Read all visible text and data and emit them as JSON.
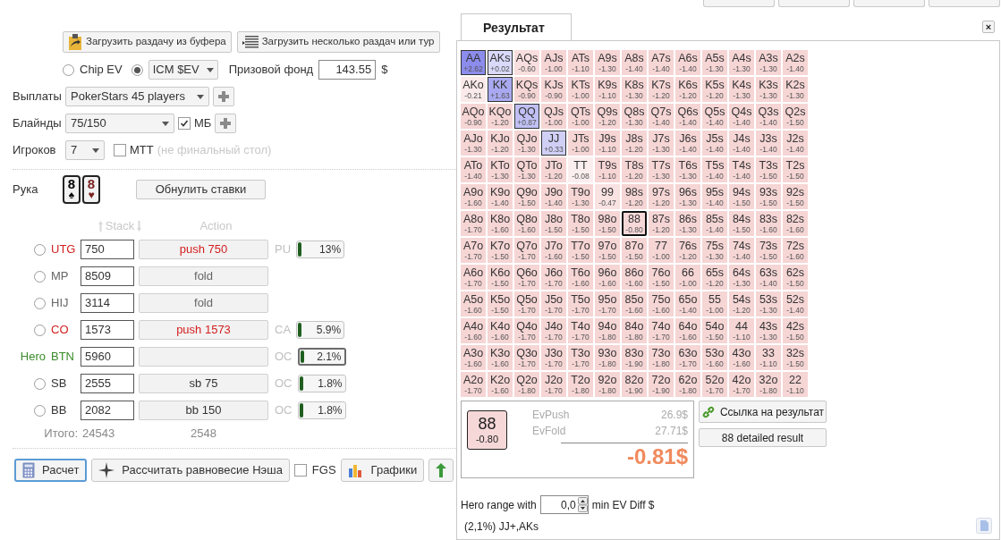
{
  "load_buttons": [
    {
      "kind": "clipboard",
      "label": "Загрузить раздачу из буфера"
    },
    {
      "kind": "list",
      "label": "Загрузить несколько раздач или тур"
    }
  ],
  "ev_options": [
    {
      "kind": "radio",
      "label": "Chip EV",
      "selected": false
    },
    {
      "kind": "dropdown",
      "label": "ICM $EV",
      "selected": true
    }
  ],
  "prize_pool": {
    "label": "Призовой фонд",
    "value": "143.55",
    "unit": "$"
  },
  "payouts": {
    "label": "Выплаты",
    "value": "PokerStars 45 players"
  },
  "blinds": {
    "label": "Блайнды",
    "value": "75/150",
    "ante_label": "МБ",
    "ante_checked": true
  },
  "players_count": {
    "label": "Игроков",
    "value": "7",
    "mtt_label": "МТТ",
    "mtt_checked": false,
    "mtt_note": "(не финальный стол)"
  },
  "hand": {
    "label": "Рука",
    "reset_button": "Обнулить ставки",
    "cards": [
      {
        "rank": "8",
        "suit": "♠",
        "color": "#000000"
      },
      {
        "rank": "8",
        "suit": "♥",
        "color": "#7a1f1f"
      }
    ]
  },
  "columns": {
    "stack": "Stack",
    "action": "Action"
  },
  "players": [
    {
      "position": "UTG",
      "hero": false,
      "selected": false,
      "stack": "750",
      "kind": "push",
      "action": "push 750",
      "stat": {
        "label": "PU",
        "level": 0.13,
        "value": "13%"
      }
    },
    {
      "position": "MP",
      "hero": false,
      "selected": false,
      "stack": "8509",
      "kind": "fold",
      "action": "fold"
    },
    {
      "position": "HIJ",
      "hero": false,
      "selected": false,
      "stack": "3114",
      "kind": "fold",
      "action": "fold"
    },
    {
      "position": "CO",
      "hero": false,
      "selected": false,
      "stack": "1573",
      "kind": "push",
      "action": "push 1573",
      "stat": {
        "label": "CA",
        "level": 0.059,
        "value": "5.9%"
      }
    },
    {
      "position": "BTN",
      "hero": true,
      "tag": "Hero",
      "stack": "5960",
      "kind": "none",
      "stat": {
        "label": "OC",
        "level": 0.021,
        "value": "2.1%"
      }
    },
    {
      "position": "SB",
      "hero": false,
      "selected": false,
      "stack": "2555",
      "kind": "post",
      "action": "sb 75",
      "stat": {
        "label": "OC",
        "level": 0.018,
        "value": "1.8%"
      }
    },
    {
      "position": "BB",
      "hero": false,
      "selected": false,
      "stack": "2082",
      "kind": "post",
      "action": "bb 150",
      "stat": {
        "label": "OC",
        "level": 0.018,
        "value": "1.8%"
      }
    }
  ],
  "totals": {
    "label": "Итого:",
    "stack": "24543",
    "action": "2548"
  },
  "actions": [
    {
      "kind": "calculate",
      "label": "Расчет",
      "selected": true
    },
    {
      "kind": "nash",
      "label": "Рассчитать равновесие Нэша",
      "selected": false
    },
    {
      "kind": "checkbox",
      "label": "FGS",
      "checked": false
    },
    {
      "kind": "charts",
      "label": "Графики",
      "selected": false
    },
    {
      "kind": "export",
      "selected": false
    }
  ],
  "result": {
    "tab": "Результат",
    "close": "×",
    "grid": [
      [
        {
          "hand": "AA",
          "ev": "+2.62",
          "in_range": true,
          "current": false
        },
        {
          "hand": "AKs",
          "ev": "+0.02",
          "in_range": true,
          "current": false
        },
        {
          "hand": "AQs",
          "ev": "-0.60",
          "in_range": false,
          "current": false
        },
        {
          "hand": "AJs",
          "ev": "-1.00",
          "in_range": false,
          "current": false
        },
        {
          "hand": "ATs",
          "ev": "-1.10",
          "in_range": false,
          "current": false
        },
        {
          "hand": "A9s",
          "ev": "-1.30",
          "in_range": false,
          "current": false
        },
        {
          "hand": "A8s",
          "ev": "-1.40",
          "in_range": false,
          "current": false
        },
        {
          "hand": "A7s",
          "ev": "-1.40",
          "in_range": false,
          "current": false
        },
        {
          "hand": "A6s",
          "ev": "-1.40",
          "in_range": false,
          "current": false
        },
        {
          "hand": "A5s",
          "ev": "-1.30",
          "in_range": false,
          "current": false
        },
        {
          "hand": "A4s",
          "ev": "-1.30",
          "in_range": false,
          "current": false
        },
        {
          "hand": "A3s",
          "ev": "-1.30",
          "in_range": false,
          "current": false
        },
        {
          "hand": "A2s",
          "ev": "-1.40",
          "in_range": false,
          "current": false
        }
      ],
      [
        {
          "hand": "AKo",
          "ev": "-0.21",
          "in_range": false,
          "current": false
        },
        {
          "hand": "KK",
          "ev": "+1.63",
          "in_range": true,
          "current": false
        },
        {
          "hand": "KQs",
          "ev": "-0.90",
          "in_range": false,
          "current": false
        },
        {
          "hand": "KJs",
          "ev": "-0.90",
          "in_range": false,
          "current": false
        },
        {
          "hand": "KTs",
          "ev": "-1.00",
          "in_range": false,
          "current": false
        },
        {
          "hand": "K9s",
          "ev": "-1.10",
          "in_range": false,
          "current": false
        },
        {
          "hand": "K8s",
          "ev": "-1.30",
          "in_range": false,
          "current": false
        },
        {
          "hand": "K7s",
          "ev": "-1.20",
          "in_range": false,
          "current": false
        },
        {
          "hand": "K6s",
          "ev": "-1.20",
          "in_range": false,
          "current": false
        },
        {
          "hand": "K5s",
          "ev": "-1.20",
          "in_range": false,
          "current": false
        },
        {
          "hand": "K4s",
          "ev": "-1.30",
          "in_range": false,
          "current": false
        },
        {
          "hand": "K3s",
          "ev": "-1.30",
          "in_range": false,
          "current": false
        },
        {
          "hand": "K2s",
          "ev": "-1.30",
          "in_range": false,
          "current": false
        }
      ],
      [
        {
          "hand": "AQo",
          "ev": "-0.90",
          "in_range": false,
          "current": false
        },
        {
          "hand": "KQo",
          "ev": "-1.20",
          "in_range": false,
          "current": false
        },
        {
          "hand": "QQ",
          "ev": "+0.87",
          "in_range": true,
          "current": false
        },
        {
          "hand": "QJs",
          "ev": "-1.00",
          "in_range": false,
          "current": false
        },
        {
          "hand": "QTs",
          "ev": "-1.00",
          "in_range": false,
          "current": false
        },
        {
          "hand": "Q9s",
          "ev": "-1.20",
          "in_range": false,
          "current": false
        },
        {
          "hand": "Q8s",
          "ev": "-1.30",
          "in_range": false,
          "current": false
        },
        {
          "hand": "Q7s",
          "ev": "-1.40",
          "in_range": false,
          "current": false
        },
        {
          "hand": "Q6s",
          "ev": "-1.40",
          "in_range": false,
          "current": false
        },
        {
          "hand": "Q5s",
          "ev": "-1.40",
          "in_range": false,
          "current": false
        },
        {
          "hand": "Q4s",
          "ev": "-1.40",
          "in_range": false,
          "current": false
        },
        {
          "hand": "Q3s",
          "ev": "-1.40",
          "in_range": false,
          "current": false
        },
        {
          "hand": "Q2s",
          "ev": "-1.50",
          "in_range": false,
          "current": false
        }
      ],
      [
        {
          "hand": "AJo",
          "ev": "-1.30",
          "in_range": false,
          "current": false
        },
        {
          "hand": "KJo",
          "ev": "-1.20",
          "in_range": false,
          "current": false
        },
        {
          "hand": "QJo",
          "ev": "-1.30",
          "in_range": false,
          "current": false
        },
        {
          "hand": "JJ",
          "ev": "+0.33",
          "in_range": true,
          "current": false
        },
        {
          "hand": "JTs",
          "ev": "-1.00",
          "in_range": false,
          "current": false
        },
        {
          "hand": "J9s",
          "ev": "-1.10",
          "in_range": false,
          "current": false
        },
        {
          "hand": "J8s",
          "ev": "-1.20",
          "in_range": false,
          "current": false
        },
        {
          "hand": "J7s",
          "ev": "-1.30",
          "in_range": false,
          "current": false
        },
        {
          "hand": "J6s",
          "ev": "-1.40",
          "in_range": false,
          "current": false
        },
        {
          "hand": "J5s",
          "ev": "-1.40",
          "in_range": false,
          "current": false
        },
        {
          "hand": "J4s",
          "ev": "-1.40",
          "in_range": false,
          "current": false
        },
        {
          "hand": "J3s",
          "ev": "-1.40",
          "in_range": false,
          "current": false
        },
        {
          "hand": "J2s",
          "ev": "-1.40",
          "in_range": false,
          "current": false
        }
      ],
      [
        {
          "hand": "ATo",
          "ev": "-1.40",
          "in_range": false,
          "current": false
        },
        {
          "hand": "KTo",
          "ev": "-1.30",
          "in_range": false,
          "current": false
        },
        {
          "hand": "QTo",
          "ev": "-1.30",
          "in_range": false,
          "current": false
        },
        {
          "hand": "JTo",
          "ev": "-1.20",
          "in_range": false,
          "current": false
        },
        {
          "hand": "TT",
          "ev": "-0.08",
          "in_range": false,
          "current": false
        },
        {
          "hand": "T9s",
          "ev": "-1.10",
          "in_range": false,
          "current": false
        },
        {
          "hand": "T8s",
          "ev": "-1.20",
          "in_range": false,
          "current": false
        },
        {
          "hand": "T7s",
          "ev": "-1.30",
          "in_range": false,
          "current": false
        },
        {
          "hand": "T6s",
          "ev": "-1.30",
          "in_range": false,
          "current": false
        },
        {
          "hand": "T5s",
          "ev": "-1.40",
          "in_range": false,
          "current": false
        },
        {
          "hand": "T4s",
          "ev": "-1.40",
          "in_range": false,
          "current": false
        },
        {
          "hand": "T3s",
          "ev": "-1.50",
          "in_range": false,
          "current": false
        },
        {
          "hand": "T2s",
          "ev": "-1.50",
          "in_range": false,
          "current": false
        }
      ],
      [
        {
          "hand": "A9o",
          "ev": "-1.60",
          "in_range": false,
          "current": false
        },
        {
          "hand": "K9o",
          "ev": "-1.40",
          "in_range": false,
          "current": false
        },
        {
          "hand": "Q9o",
          "ev": "-1.50",
          "in_range": false,
          "current": false
        },
        {
          "hand": "J9o",
          "ev": "-1.40",
          "in_range": false,
          "current": false
        },
        {
          "hand": "T9o",
          "ev": "-1.30",
          "in_range": false,
          "current": false
        },
        {
          "hand": "99",
          "ev": "-0.47",
          "in_range": false,
          "current": false
        },
        {
          "hand": "98s",
          "ev": "-1.20",
          "in_range": false,
          "current": false
        },
        {
          "hand": "97s",
          "ev": "-1.20",
          "in_range": false,
          "current": false
        },
        {
          "hand": "96s",
          "ev": "-1.30",
          "in_range": false,
          "current": false
        },
        {
          "hand": "95s",
          "ev": "-1.40",
          "in_range": false,
          "current": false
        },
        {
          "hand": "94s",
          "ev": "-1.50",
          "in_range": false,
          "current": false
        },
        {
          "hand": "93s",
          "ev": "-1.50",
          "in_range": false,
          "current": false
        },
        {
          "hand": "92s",
          "ev": "-1.50",
          "in_range": false,
          "current": false
        }
      ],
      [
        {
          "hand": "A8o",
          "ev": "-1.70",
          "in_range": false,
          "current": false
        },
        {
          "hand": "K8o",
          "ev": "-1.60",
          "in_range": false,
          "current": false
        },
        {
          "hand": "Q8o",
          "ev": "-1.60",
          "in_range": false,
          "current": false
        },
        {
          "hand": "J8o",
          "ev": "-1.50",
          "in_range": false,
          "current": false
        },
        {
          "hand": "T8o",
          "ev": "-1.50",
          "in_range": false,
          "current": false
        },
        {
          "hand": "98o",
          "ev": "-1.50",
          "in_range": false,
          "current": false
        },
        {
          "hand": "88",
          "ev": "-0.80",
          "in_range": false,
          "current": true
        },
        {
          "hand": "87s",
          "ev": "-1.20",
          "in_range": false,
          "current": false
        },
        {
          "hand": "86s",
          "ev": "-1.30",
          "in_range": false,
          "current": false
        },
        {
          "hand": "85s",
          "ev": "-1.40",
          "in_range": false,
          "current": false
        },
        {
          "hand": "84s",
          "ev": "-1.50",
          "in_range": false,
          "current": false
        },
        {
          "hand": "83s",
          "ev": "-1.60",
          "in_range": false,
          "current": false
        },
        {
          "hand": "82s",
          "ev": "-1.60",
          "in_range": false,
          "current": false
        }
      ],
      [
        {
          "hand": "A7o",
          "ev": "-1.70",
          "in_range": false,
          "current": false
        },
        {
          "hand": "K7o",
          "ev": "-1.50",
          "in_range": false,
          "current": false
        },
        {
          "hand": "Q7o",
          "ev": "-1.70",
          "in_range": false,
          "current": false
        },
        {
          "hand": "J7o",
          "ev": "-1.60",
          "in_range": false,
          "current": false
        },
        {
          "hand": "T7o",
          "ev": "-1.50",
          "in_range": false,
          "current": false
        },
        {
          "hand": "97o",
          "ev": "-1.50",
          "in_range": false,
          "current": false
        },
        {
          "hand": "87o",
          "ev": "-1.50",
          "in_range": false,
          "current": false
        },
        {
          "hand": "77",
          "ev": "-1.00",
          "in_range": false,
          "current": false
        },
        {
          "hand": "76s",
          "ev": "-1.20",
          "in_range": false,
          "current": false
        },
        {
          "hand": "75s",
          "ev": "-1.30",
          "in_range": false,
          "current": false
        },
        {
          "hand": "74s",
          "ev": "-1.40",
          "in_range": false,
          "current": false
        },
        {
          "hand": "73s",
          "ev": "-1.50",
          "in_range": false,
          "current": false
        },
        {
          "hand": "72s",
          "ev": "-1.60",
          "in_range": false,
          "current": false
        }
      ],
      [
        {
          "hand": "A6o",
          "ev": "-1.70",
          "in_range": false,
          "current": false
        },
        {
          "hand": "K6o",
          "ev": "-1.50",
          "in_range": false,
          "current": false
        },
        {
          "hand": "Q6o",
          "ev": "-1.70",
          "in_range": false,
          "current": false
        },
        {
          "hand": "J6o",
          "ev": "-1.70",
          "in_range": false,
          "current": false
        },
        {
          "hand": "T6o",
          "ev": "-1.60",
          "in_range": false,
          "current": false
        },
        {
          "hand": "96o",
          "ev": "-1.60",
          "in_range": false,
          "current": false
        },
        {
          "hand": "86o",
          "ev": "-1.60",
          "in_range": false,
          "current": false
        },
        {
          "hand": "76o",
          "ev": "-1.50",
          "in_range": false,
          "current": false
        },
        {
          "hand": "66",
          "ev": "-1.00",
          "in_range": false,
          "current": false
        },
        {
          "hand": "65s",
          "ev": "-1.20",
          "in_range": false,
          "current": false
        },
        {
          "hand": "64s",
          "ev": "-1.30",
          "in_range": false,
          "current": false
        },
        {
          "hand": "63s",
          "ev": "-1.40",
          "in_range": false,
          "current": false
        },
        {
          "hand": "62s",
          "ev": "-1.50",
          "in_range": false,
          "current": false
        }
      ],
      [
        {
          "hand": "A5o",
          "ev": "-1.60",
          "in_range": false,
          "current": false
        },
        {
          "hand": "K5o",
          "ev": "-1.50",
          "in_range": false,
          "current": false
        },
        {
          "hand": "Q5o",
          "ev": "-1.70",
          "in_range": false,
          "current": false
        },
        {
          "hand": "J5o",
          "ev": "-1.70",
          "in_range": false,
          "current": false
        },
        {
          "hand": "T5o",
          "ev": "-1.70",
          "in_range": false,
          "current": false
        },
        {
          "hand": "95o",
          "ev": "-1.70",
          "in_range": false,
          "current": false
        },
        {
          "hand": "85o",
          "ev": "-1.60",
          "in_range": false,
          "current": false
        },
        {
          "hand": "75o",
          "ev": "-1.60",
          "in_range": false,
          "current": false
        },
        {
          "hand": "65o",
          "ev": "-1.40",
          "in_range": false,
          "current": false
        },
        {
          "hand": "55",
          "ev": "-1.00",
          "in_range": false,
          "current": false
        },
        {
          "hand": "54s",
          "ev": "-1.20",
          "in_range": false,
          "current": false
        },
        {
          "hand": "53s",
          "ev": "-1.30",
          "in_range": false,
          "current": false
        },
        {
          "hand": "52s",
          "ev": "-1.40",
          "in_range": false,
          "current": false
        }
      ],
      [
        {
          "hand": "A4o",
          "ev": "-1.60",
          "in_range": false,
          "current": false
        },
        {
          "hand": "K4o",
          "ev": "-1.60",
          "in_range": false,
          "current": false
        },
        {
          "hand": "Q4o",
          "ev": "-1.70",
          "in_range": false,
          "current": false
        },
        {
          "hand": "J4o",
          "ev": "-1.70",
          "in_range": false,
          "current": false
        },
        {
          "hand": "T4o",
          "ev": "-1.70",
          "in_range": false,
          "current": false
        },
        {
          "hand": "94o",
          "ev": "-1.80",
          "in_range": false,
          "current": false
        },
        {
          "hand": "84o",
          "ev": "-1.80",
          "in_range": false,
          "current": false
        },
        {
          "hand": "74o",
          "ev": "-1.70",
          "in_range": false,
          "current": false
        },
        {
          "hand": "64o",
          "ev": "-1.60",
          "in_range": false,
          "current": false
        },
        {
          "hand": "54o",
          "ev": "-1.50",
          "in_range": false,
          "current": false
        },
        {
          "hand": "44",
          "ev": "-1.10",
          "in_range": false,
          "current": false
        },
        {
          "hand": "43s",
          "ev": "-1.30",
          "in_range": false,
          "current": false
        },
        {
          "hand": "42s",
          "ev": "-1.50",
          "in_range": false,
          "current": false
        }
      ],
      [
        {
          "hand": "A3o",
          "ev": "-1.60",
          "in_range": false,
          "current": false
        },
        {
          "hand": "K3o",
          "ev": "-1.60",
          "in_range": false,
          "current": false
        },
        {
          "hand": "Q3o",
          "ev": "-1.70",
          "in_range": false,
          "current": false
        },
        {
          "hand": "J3o",
          "ev": "-1.70",
          "in_range": false,
          "current": false
        },
        {
          "hand": "T3o",
          "ev": "-1.70",
          "in_range": false,
          "current": false
        },
        {
          "hand": "93o",
          "ev": "-1.80",
          "in_range": false,
          "current": false
        },
        {
          "hand": "83o",
          "ev": "-1.90",
          "in_range": false,
          "current": false
        },
        {
          "hand": "73o",
          "ev": "-1.80",
          "in_range": false,
          "current": false
        },
        {
          "hand": "63o",
          "ev": "-1.70",
          "in_range": false,
          "current": false
        },
        {
          "hand": "53o",
          "ev": "-1.60",
          "in_range": false,
          "current": false
        },
        {
          "hand": "43o",
          "ev": "-1.60",
          "in_range": false,
          "current": false
        },
        {
          "hand": "33",
          "ev": "-1.10",
          "in_range": false,
          "current": false
        },
        {
          "hand": "32s",
          "ev": "-1.50",
          "in_range": false,
          "current": false
        }
      ],
      [
        {
          "hand": "A2o",
          "ev": "-1.70",
          "in_range": false,
          "current": false
        },
        {
          "hand": "K2o",
          "ev": "-1.60",
          "in_range": false,
          "current": false
        },
        {
          "hand": "Q2o",
          "ev": "-1.80",
          "in_range": false,
          "current": false
        },
        {
          "hand": "J2o",
          "ev": "-1.70",
          "in_range": false,
          "current": false
        },
        {
          "hand": "T2o",
          "ev": "-1.80",
          "in_range": false,
          "current": false
        },
        {
          "hand": "92o",
          "ev": "-1.80",
          "in_range": false,
          "current": false
        },
        {
          "hand": "82o",
          "ev": "-1.90",
          "in_range": false,
          "current": false
        },
        {
          "hand": "72o",
          "ev": "-1.90",
          "in_range": false,
          "current": false
        },
        {
          "hand": "62o",
          "ev": "-1.80",
          "in_range": false,
          "current": false
        },
        {
          "hand": "52o",
          "ev": "-1.70",
          "in_range": false,
          "current": false
        },
        {
          "hand": "42o",
          "ev": "-1.70",
          "in_range": false,
          "current": false
        },
        {
          "hand": "32o",
          "ev": "-1.80",
          "in_range": false,
          "current": false
        },
        {
          "hand": "22",
          "ev": "-1.10",
          "in_range": false,
          "current": false
        }
      ]
    ],
    "hand_card": {
      "hand": "88",
      "ev": "-0.80"
    },
    "ev_push": {
      "label": "EvPush",
      "value": "26.9$"
    },
    "ev_fold": {
      "label": "EvFold",
      "value": "27.71$"
    },
    "diff": "-0.81$",
    "link_button": "Ссылка на результат",
    "detail_button": "88 detailed result",
    "range_filter": {
      "prefix": "Hero range with",
      "value": "0,0",
      "suffix": "min EV Diff $"
    },
    "range_text": "(2,1%) JJ+,AKs"
  }
}
